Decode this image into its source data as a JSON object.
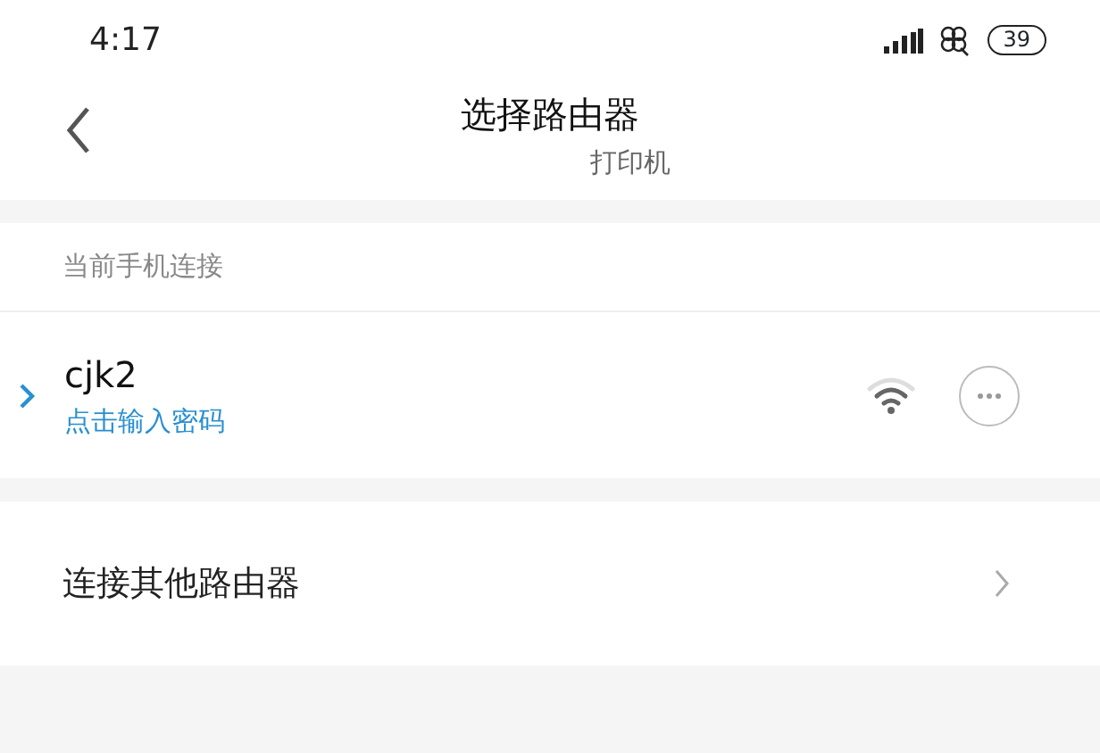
{
  "status_bar": {
    "time": "4:17",
    "battery": "39"
  },
  "header": {
    "title": "选择路由器",
    "subtitle": "打印机"
  },
  "section_label": "当前手机连接",
  "current_network": {
    "name": "cjk2",
    "hint": "点击输入密码",
    "expanded": false
  },
  "other_item": {
    "label": "连接其他路由器"
  }
}
